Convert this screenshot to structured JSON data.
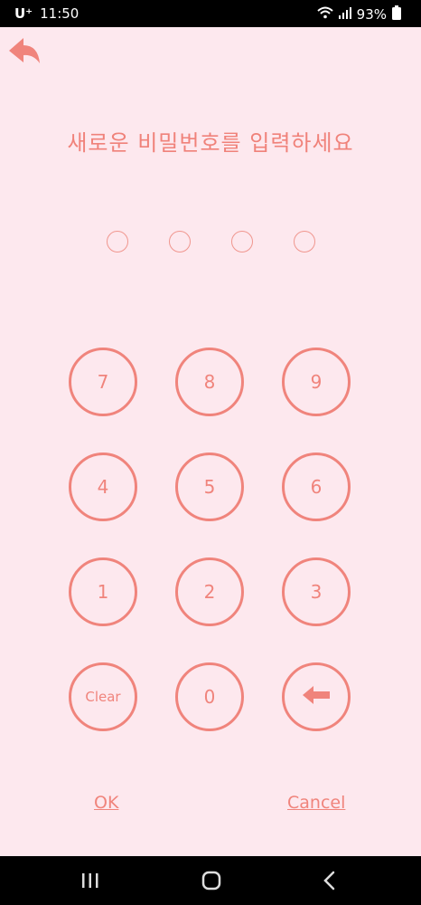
{
  "status": {
    "carrier": "U⁺",
    "time": "11:50",
    "battery": "93%",
    "icons": [
      "wifi-icon",
      "signal-icon",
      "battery-icon"
    ]
  },
  "header": {
    "back_icon": "back-arrow-icon",
    "title": "새로운 비밀번호를 입력하세요"
  },
  "pin": {
    "length": 4,
    "filled": 0
  },
  "keypad": {
    "keys": [
      "7",
      "8",
      "9",
      "4",
      "5",
      "6",
      "1",
      "2",
      "3",
      "Clear",
      "0",
      "backspace"
    ],
    "backspace_icon": "backspace-arrow-icon"
  },
  "actions": {
    "ok_label": "OK",
    "cancel_label": "Cancel"
  },
  "nav": {
    "buttons": [
      "recent-apps-icon",
      "home-icon",
      "back-icon"
    ]
  },
  "colors": {
    "background": "#fde8ee",
    "accent": "#f0847c",
    "status_bar": "#000000"
  }
}
